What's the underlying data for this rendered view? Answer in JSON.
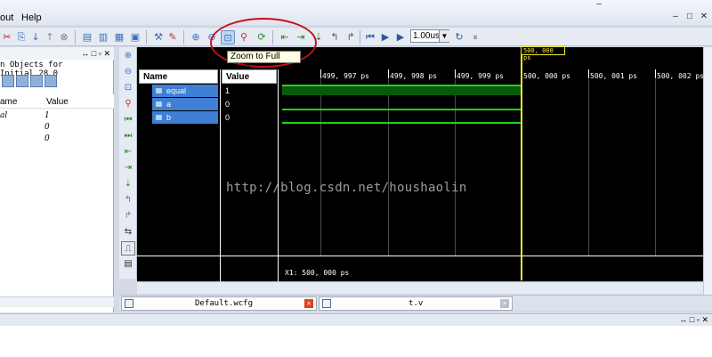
{
  "menu": {
    "items": [
      "out",
      "Help"
    ]
  },
  "toolbar": {
    "zoom_value": "1.00us",
    "tooltip": "Zoom to Full View"
  },
  "left_panel": {
    "title": "n Objects for Initial_28_0",
    "columns": [
      "ame",
      "Value"
    ],
    "rows": [
      {
        "name": "al",
        "value": "1"
      },
      {
        "name": "",
        "value": "0"
      },
      {
        "name": "",
        "value": "0"
      }
    ]
  },
  "waveform": {
    "columns": {
      "name": "Name",
      "value": "Value"
    },
    "signals": [
      {
        "name": "equal",
        "value": "1"
      },
      {
        "name": "a",
        "value": "0"
      },
      {
        "name": "b",
        "value": "0"
      }
    ],
    "ruler": [
      "499, 997 ps",
      "499, 998 ps",
      "499, 999 ps",
      "500, 000 ps",
      "500, 001 ps",
      "500, 002 ps"
    ],
    "cursor_label": "500, 000 ps",
    "x1_readout": "X1: 500, 000 ps",
    "trace_color": "#20d020",
    "cursor_color": "#f4ea2a"
  },
  "tabs": [
    {
      "label": "Default.wcfg"
    },
    {
      "label": "t.v"
    }
  ],
  "watermark": "http://blog.csdn.net/houshaolin"
}
